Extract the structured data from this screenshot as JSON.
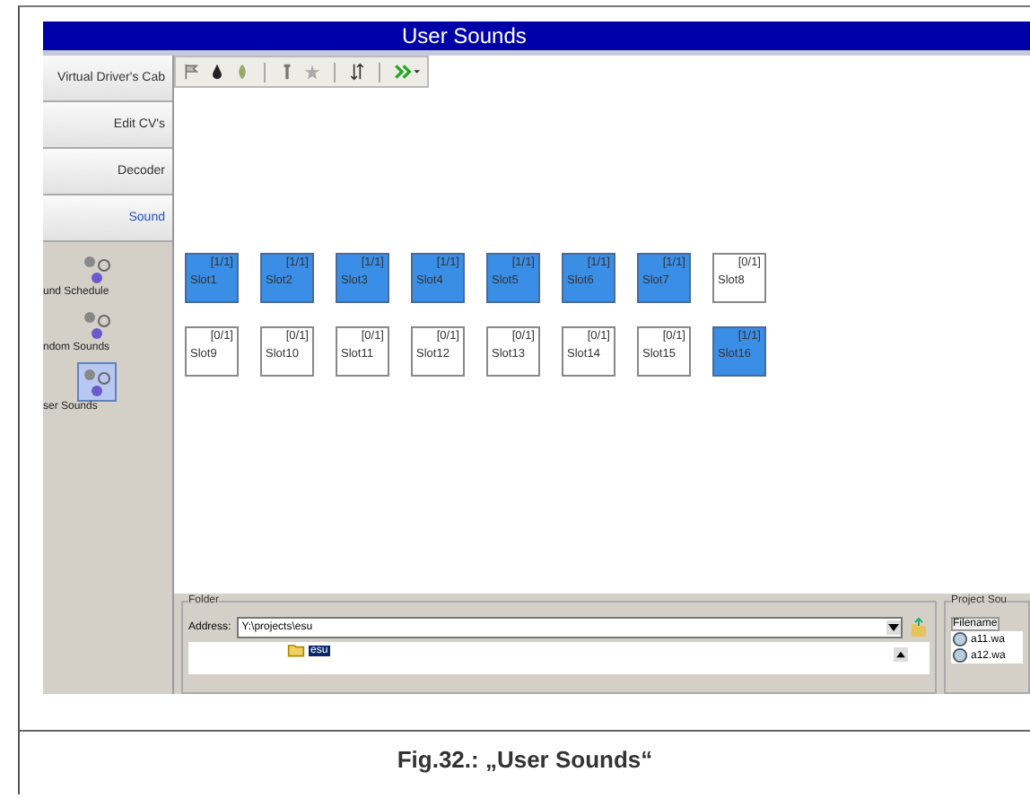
{
  "window": {
    "title": "User Sounds"
  },
  "nav_buttons": [
    {
      "label": "Virtual Driver's Cab",
      "selected": false
    },
    {
      "label": "Edit CV's",
      "selected": false
    },
    {
      "label": "Decoder",
      "selected": false
    },
    {
      "label": "Sound",
      "selected": true
    }
  ],
  "sound_items": [
    {
      "label": "und Schedule",
      "selected": false
    },
    {
      "label": "ndom Sounds",
      "selected": false
    },
    {
      "label": "ser Sounds",
      "selected": true
    }
  ],
  "slots": [
    {
      "count": "[1/1]",
      "label": "Slot1",
      "filled": true
    },
    {
      "count": "[1/1]",
      "label": "Slot2",
      "filled": true
    },
    {
      "count": "[1/1]",
      "label": "Slot3",
      "filled": true
    },
    {
      "count": "[1/1]",
      "label": "Slot4",
      "filled": true
    },
    {
      "count": "[1/1]",
      "label": "Slot5",
      "filled": true
    },
    {
      "count": "[1/1]",
      "label": "Slot6",
      "filled": true
    },
    {
      "count": "[1/1]",
      "label": "Slot7",
      "filled": true
    },
    {
      "count": "[0/1]",
      "label": "Slot8",
      "filled": false
    },
    {
      "count": "[0/1]",
      "label": "Slot9",
      "filled": false
    },
    {
      "count": "[0/1]",
      "label": "Slot10",
      "filled": false
    },
    {
      "count": "[0/1]",
      "label": "Slot11",
      "filled": false
    },
    {
      "count": "[0/1]",
      "label": "Slot12",
      "filled": false
    },
    {
      "count": "[0/1]",
      "label": "Slot13",
      "filled": false
    },
    {
      "count": "[0/1]",
      "label": "Slot14",
      "filled": false
    },
    {
      "count": "[0/1]",
      "label": "Slot15",
      "filled": false
    },
    {
      "count": "[1/1]",
      "label": "Slot16",
      "filled": true
    }
  ],
  "folder": {
    "title": "Folder",
    "address_label": "Address:",
    "address": "Y:\\projects\\esu",
    "tree": [
      {
        "label": "esu",
        "selected": true
      }
    ]
  },
  "project_sounds": {
    "title": "Project Sou",
    "column": "Filename",
    "files": [
      "a11.wa",
      "a12.wa"
    ]
  },
  "caption": "Fig.32.: „User Sounds“"
}
